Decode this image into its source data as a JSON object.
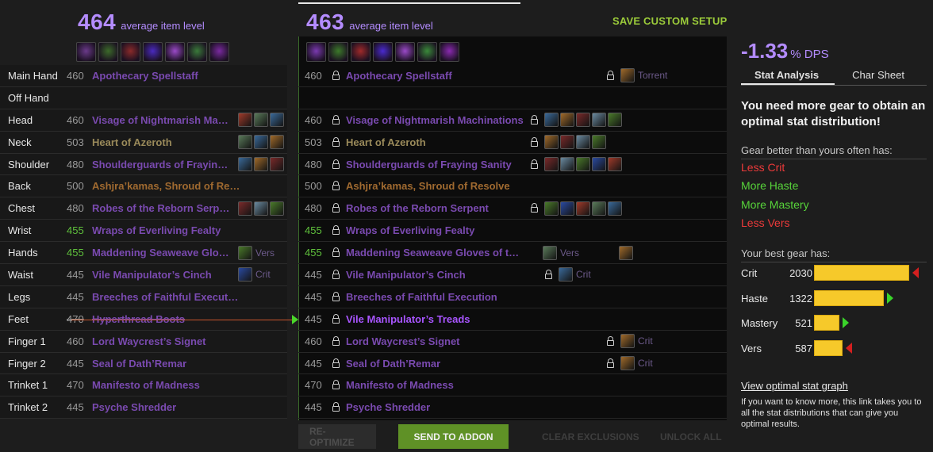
{
  "left": {
    "ilvl": "464",
    "ilvl_label": "average item level",
    "essences": [
      "#6a3a8a",
      "#3c6a2a",
      "#8a2a2a",
      "#4a2ac0",
      "#9a4ac8",
      "#3a7a3a",
      "#7a2aa0"
    ]
  },
  "right": {
    "ilvl": "463",
    "ilvl_label": "average item level",
    "save_label": "SAVE CUSTOM SETUP",
    "essences": [
      "#7a3ab0",
      "#3c7a2a",
      "#a02a2a",
      "#4a2ad0",
      "#9a4ac8",
      "#3a8a3a",
      "#8a2ab0"
    ]
  },
  "slots": [
    {
      "slot": "Main Hand",
      "lvl": "460",
      "item": "Apothecary Spellstaff",
      "rlvl": "460",
      "ritem": "Apothecary Spellstaff",
      "rextra": "Torrent"
    },
    {
      "slot": "Off Hand",
      "lvl": "",
      "item": "",
      "rlvl": "",
      "ritem": "",
      "rextra": ""
    },
    {
      "slot": "Head",
      "lvl": "460",
      "item": "Visage of Nightmarish Mac…",
      "rlvl": "460",
      "ritem": "Visage of Nightmarish Machinations",
      "rextra": ""
    },
    {
      "slot": "Neck",
      "lvl": "503",
      "item": "Heart of Azeroth",
      "rlvl": "503",
      "ritem": "Heart of Azeroth",
      "rextra": ""
    },
    {
      "slot": "Shoulder",
      "lvl": "480",
      "item": "Shoulderguards of Fraying …",
      "rlvl": "480",
      "ritem": "Shoulderguards of Fraying Sanity",
      "rextra": ""
    },
    {
      "slot": "Back",
      "lvl": "500",
      "item": "Ashjra’kamas, Shroud of Re…",
      "rlvl": "500",
      "ritem": "Ashjra’kamas, Shroud of Resolve",
      "rextra": ""
    },
    {
      "slot": "Chest",
      "lvl": "480",
      "item": "Robes of the Reborn Serpent",
      "rlvl": "480",
      "ritem": "Robes of the Reborn Serpent",
      "rextra": ""
    },
    {
      "slot": "Wrist",
      "lvl": "455",
      "item": "Wraps of Everliving Fealty",
      "rlvl": "455",
      "ritem": "Wraps of Everliving Fealty",
      "rextra": ""
    },
    {
      "slot": "Hands",
      "lvl": "455",
      "item": "Maddening Seaweave Glove…",
      "extra": "Vers",
      "rlvl": "455",
      "ritem": "Maddening Seaweave Gloves of the …",
      "rextra": "Vers"
    },
    {
      "slot": "Waist",
      "lvl": "445",
      "item": "Vile Manipulator’s Cinch",
      "extra": "Crit",
      "rlvl": "445",
      "ritem": "Vile Manipulator’s Cinch",
      "rextra": "Crit"
    },
    {
      "slot": "Legs",
      "lvl": "445",
      "item": "Breeches of Faithful Execut…",
      "rlvl": "445",
      "ritem": "Breeches of Faithful Execution",
      "rextra": ""
    },
    {
      "slot": "Feet",
      "lvl": "470",
      "item": "Hyperthread Boots",
      "rlvl": "445",
      "ritem": "Vile Manipulator’s Treads",
      "rextra": ""
    },
    {
      "slot": "Finger 1",
      "lvl": "460",
      "item": "Lord Waycrest’s Signet",
      "rlvl": "460",
      "ritem": "Lord Waycrest’s Signet",
      "rextra": "Crit"
    },
    {
      "slot": "Finger 2",
      "lvl": "445",
      "item": "Seal of Dath’Remar",
      "rlvl": "445",
      "ritem": "Seal of Dath’Remar",
      "rextra": "Crit"
    },
    {
      "slot": "Trinket 1",
      "lvl": "470",
      "item": "Manifesto of Madness",
      "rlvl": "470",
      "ritem": "Manifesto of Madness",
      "rextra": ""
    },
    {
      "slot": "Trinket 2",
      "lvl": "445",
      "item": "Psyche Shredder",
      "rlvl": "445",
      "ritem": "Psyche Shredder",
      "rextra": ""
    }
  ],
  "buttons": {
    "reoptimize": "RE-OPTIMIZE",
    "send": "SEND TO ADDON",
    "clear": "CLEAR EXCLUSIONS",
    "unlock": "UNLOCK ALL"
  },
  "sidebar": {
    "dps": "-1.33",
    "dps_unit": "% DPS",
    "tab_active": "Stat Analysis",
    "tab_other": "Char Sheet",
    "message": "You need more gear to obtain an optimal stat distribution!",
    "better_heading": "Gear better than yours often has:",
    "less_crit": "Less Crit",
    "more_haste": "More Haste",
    "more_mastery": "More Mastery",
    "less_vers": "Less Vers",
    "best_heading": "Your best gear has:",
    "stats": [
      {
        "name": "Crit",
        "value": "2030",
        "fraction": 1.0,
        "dir": "down"
      },
      {
        "name": "Haste",
        "value": "1322",
        "fraction": 0.73,
        "dir": "up"
      },
      {
        "name": "Mastery",
        "value": "521",
        "fraction": 0.27,
        "dir": "up"
      },
      {
        "name": "Vers",
        "value": "587",
        "fraction": 0.3,
        "dir": "down"
      }
    ],
    "link": "View optimal stat graph",
    "note": "If you want to know more, this link takes you to all the stat distributions that can give you optimal results."
  }
}
